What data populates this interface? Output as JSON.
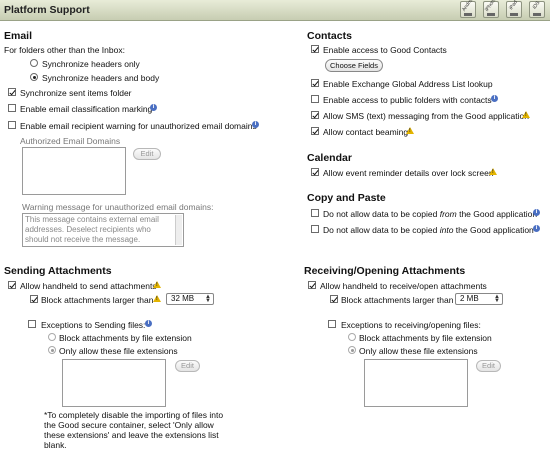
{
  "title": "Platform Support",
  "platforms": [
    "Android",
    "iPhone",
    "iPad",
    "iOS"
  ],
  "email": {
    "heading": "Email",
    "folders_label": "For folders other than the Inbox:",
    "radio_headers_only": "Synchronize headers only",
    "radio_headers_body": "Synchronize headers and body",
    "sync_sent": "Synchronize sent items folder",
    "classification": "Enable email classification marking",
    "recipient_warning": "Enable email recipient warning for unauthorized email domains",
    "authorized_domains_label": "Authorized Email Domains",
    "edit": "Edit",
    "warning_message_label": "Warning message for unauthorized email domains:",
    "warning_message_text": "This message contains external email addresses.  Deselect recipients who should not receive the message."
  },
  "contacts": {
    "heading": "Contacts",
    "access_good_contacts": "Enable access to Good Contacts",
    "choose_fields": "Choose Fields",
    "gal_lookup": "Enable Exchange Global Address List lookup",
    "public_folders": "Enable access to public folders with contacts",
    "sms": "Allow SMS (text) messaging from the Good application",
    "beaming": "Allow contact beaming"
  },
  "calendar": {
    "heading": "Calendar",
    "reminder": "Allow event reminder details over lock screen"
  },
  "copy_paste": {
    "heading": "Copy and Paste",
    "from_prefix": "Do not allow data to be copied ",
    "from_word": "from",
    "to_word": "into",
    "suffix": " the Good application"
  },
  "sending": {
    "heading": "Sending Attachments",
    "allow": "Allow handheld to send attachments",
    "block_larger": "Block attachments larger than",
    "size": "32 MB",
    "exceptions": "Exceptions to Sending files:",
    "by_extension": "Block attachments by file extension",
    "only_allow": "Only allow these file extensions",
    "edit": "Edit",
    "note": "*To completely disable the importing of files into the Good secure container, select 'Only allow these extensions' and leave the extensions list blank."
  },
  "receiving": {
    "heading": "Receiving/Opening Attachments",
    "allow": "Allow handheld to receive/open attachments",
    "block_larger": "Block attachments larger than",
    "size": "2 MB",
    "exceptions": "Exceptions to receiving/opening files:",
    "by_extension": "Block attachments by file extension",
    "only_allow": "Only allow these file extensions",
    "edit": "Edit"
  },
  "colors": {
    "titlebar": "#c7cdb2",
    "info": "#4a6fc2",
    "warning": "#e3b400"
  }
}
